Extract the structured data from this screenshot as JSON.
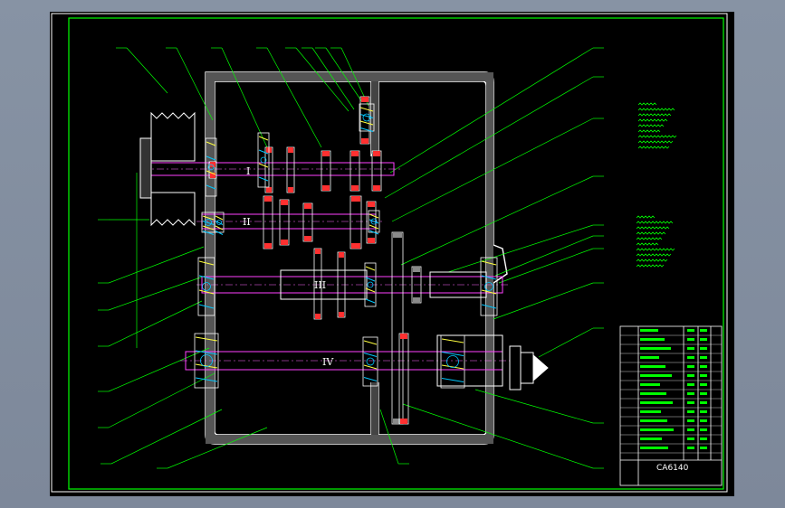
{
  "drawing": {
    "shaft_labels": [
      "I",
      "II",
      "III",
      "IV"
    ],
    "title_block_text": "CA6140",
    "tech_notes_count": 2,
    "leader_count_left": 12,
    "leader_count_right": 14,
    "leader_count_top": 8
  },
  "colors": {
    "background": "#000000",
    "frame": "#00ff00",
    "housing": "#ffffff",
    "gear_red": "#ff3030",
    "shaft_magenta": "#ff40ff",
    "centerline": "#ff66ff",
    "hatch_yellow": "#ffff40",
    "hatch_cyan": "#00c8ff",
    "leader": "#00ff00",
    "gear_grey": "#8a8a8a"
  }
}
